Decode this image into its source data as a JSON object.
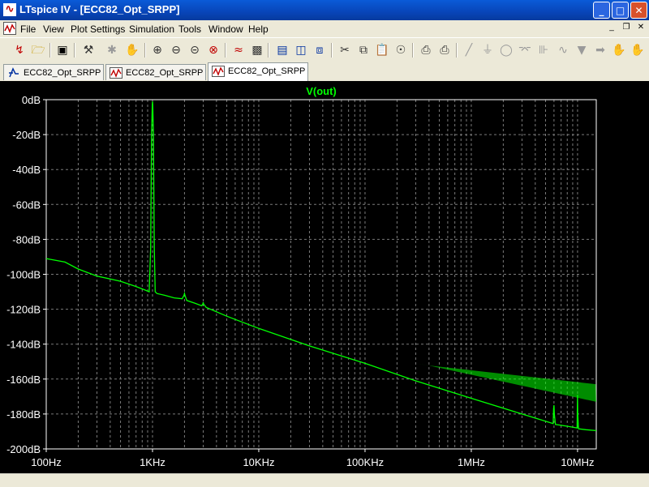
{
  "window": {
    "title": "LTspice IV - [ECC82_Opt_SRPP]",
    "app_icon_glyph": "∿",
    "minimize_glyph": "_",
    "maximize_glyph": "□",
    "close_glyph": "✕"
  },
  "menu": {
    "items": [
      "File",
      "View",
      "Plot Settings",
      "Simulation",
      "Tools",
      "Window",
      "Help"
    ],
    "mdi_minimize": "_",
    "mdi_restore": "❐",
    "mdi_close": "✕"
  },
  "toolbar": {
    "icons": [
      "open-schematic-icon",
      "open-file-icon",
      "save-icon",
      "control-panel-icon",
      "run-icon",
      "halt-icon",
      "pan-icon",
      "zoom-in-icon",
      "zoom-out-icon",
      "zoom-fit-icon",
      "zoom-cancel-icon",
      "autorange-icon",
      "new-plot-pane-icon",
      "tile-horizontal-icon",
      "tile-vertical-icon",
      "cascade-icon",
      "cut-icon",
      "copy-icon",
      "paste-icon",
      "find-icon",
      "print-preview-icon",
      "print-icon",
      "wire-icon",
      "ground-icon",
      "label-icon",
      "resistor-icon",
      "capacitor-icon",
      "inductor-icon",
      "diode-icon",
      "component-icon",
      "move-icon"
    ]
  },
  "tabs": [
    {
      "label": "ECC82_Opt_SRPP",
      "icon": "schematic-icon",
      "active": false
    },
    {
      "label": "ECC82_Opt_SRPP",
      "icon": "waveform-icon",
      "active": false
    },
    {
      "label": "ECC82_Opt_SRPP",
      "icon": "waveform-icon",
      "active": true
    }
  ],
  "chart_data": {
    "type": "line",
    "title": "V(out)",
    "xscale": "log",
    "xlim": [
      100,
      15000000
    ],
    "ylim": [
      -200,
      0
    ],
    "x_ticks": [
      "100Hz",
      "1KHz",
      "10KHz",
      "100KHz",
      "1MHz",
      "10MHz"
    ],
    "y_ticks": [
      "0dB",
      "-20dB",
      "-40dB",
      "-60dB",
      "-80dB",
      "-100dB",
      "-120dB",
      "-140dB",
      "-160dB",
      "-180dB",
      "-200dB"
    ],
    "grid": true,
    "series": [
      {
        "name": "V(out)",
        "color": "#00ff00",
        "x": [
          100,
          150,
          200,
          300,
          500,
          700,
          850,
          930,
          960,
          980,
          995,
          1000,
          1005,
          1020,
          1040,
          1060,
          1080,
          1100,
          1300,
          1600,
          1900,
          1980,
          2000,
          2020,
          2100,
          2500,
          2900,
          2980,
          3000,
          3020,
          3200,
          5000,
          10000,
          30000,
          100000,
          300000,
          1000000,
          3000000,
          5900000,
          5950000,
          6000000,
          6050000,
          6200000,
          8000000,
          9900000,
          9950000,
          10000000,
          10050000,
          10200000,
          12000000,
          15000000
        ],
        "y": [
          -91,
          -93,
          -97,
          -101,
          -104,
          -107,
          -109,
          -110,
          -85,
          -20,
          -3,
          -1,
          -3,
          -20,
          -85,
          -110,
          -110.5,
          -111,
          -112,
          -113.5,
          -114,
          -112,
          -111,
          -112,
          -115,
          -116.5,
          -118,
          -117,
          -116,
          -117,
          -119,
          -124,
          -131,
          -141,
          -151,
          -161,
          -171,
          -180,
          -185.5,
          -177,
          -175,
          -180,
          -186,
          -187,
          -188,
          -178,
          -169,
          -180,
          -188.5,
          -189,
          -189.5
        ]
      }
    ]
  }
}
